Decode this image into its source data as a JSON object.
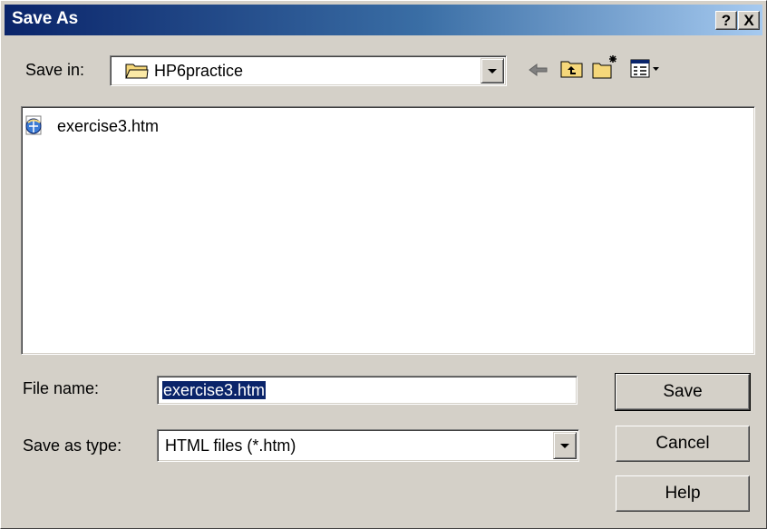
{
  "window": {
    "title": "Save As",
    "help_button": "?",
    "close_button": "X",
    "titlebar_gradient": [
      "#0a246a",
      "#a6caf0"
    ]
  },
  "toolbar": {
    "save_in_label": "Save in:",
    "save_in_value": "HP6practice",
    "icons": [
      "back-arrow-icon",
      "up-folder-icon",
      "new-folder-icon",
      "view-menu-icon"
    ]
  },
  "file_list": {
    "items": [
      {
        "name": "exercise3.htm",
        "icon": "html-file-icon"
      }
    ]
  },
  "form": {
    "file_name_label": "File name:",
    "file_name_value": "exercise3.htm",
    "save_as_type_label": "Save as type:",
    "save_as_type_value": "HTML files (*.htm)"
  },
  "buttons": {
    "save": "Save",
    "cancel": "Cancel",
    "help": "Help"
  },
  "colors": {
    "face": "#d4d0c8",
    "selection": "#0a246a"
  }
}
